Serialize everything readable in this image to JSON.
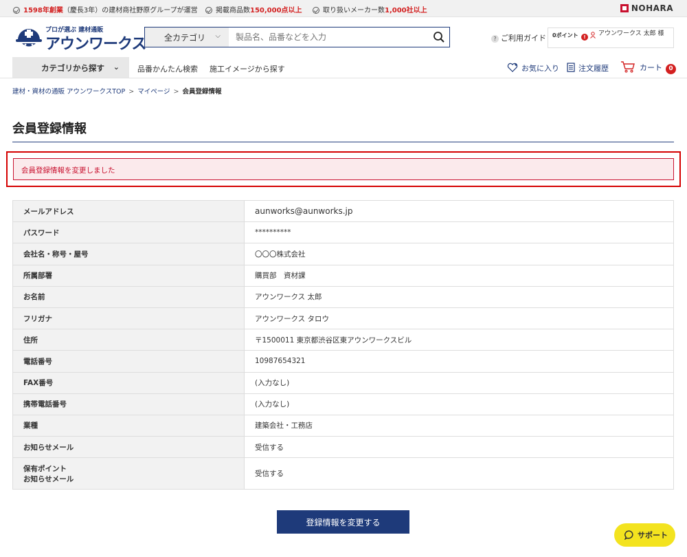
{
  "topbar": {
    "item1_red": "1598年創業",
    "item1_rest": "（慶長3年）の建材商社野原グループが運営",
    "item2_text": "掲載商品数",
    "item2_red": "150,000点以上",
    "item3_text": "取り扱いメーカー数",
    "item3_red": "1,000社以上",
    "brand": "NOHARA"
  },
  "header": {
    "logo_tagline": "プロが選ぶ 建材通販",
    "logo_name": "アウンワークス",
    "search_category": "全カテゴリ",
    "search_placeholder": "製品名、品番などを入力",
    "guide_label": "ご利用ガイド",
    "points": "0ポイント",
    "alert": "!",
    "user_name": "アウンワークス 太郎 様"
  },
  "nav": {
    "category_button": "カテゴリから探す",
    "links": [
      "品番かんたん検索",
      "施工イメージから探す"
    ],
    "favorites": "お気に入り",
    "order_history": "注文履歴",
    "cart": "カート",
    "cart_count": "0"
  },
  "breadcrumb": {
    "items": [
      "建材・資材の通販 アウンワークスTOP",
      "マイページ"
    ],
    "separator": ">",
    "current": "会員登録情報"
  },
  "page_title": "会員登録情報",
  "notice": "会員登録情報を変更しました",
  "info_rows": [
    {
      "label": "メールアドレス",
      "value": "aunworks@aunworks.jp"
    },
    {
      "label": "パスワード",
      "value": "**********"
    },
    {
      "label": "会社名・称号・屋号",
      "value": "〇〇〇株式会社"
    },
    {
      "label": "所属部署",
      "value": "購買部　資材課"
    },
    {
      "label": "お名前",
      "value": "アウンワークス 太郎"
    },
    {
      "label": "フリガナ",
      "value": "アウンワークス タロウ"
    },
    {
      "label": "住所",
      "value": "〒1500011 東京都渋谷区東アウンワークスビル"
    },
    {
      "label": "電話番号",
      "value": "10987654321"
    },
    {
      "label": "FAX番号",
      "value": "(入力なし)"
    },
    {
      "label": "携帯電話番号",
      "value": "(入力なし)"
    },
    {
      "label": "業種",
      "value": "建築会社・工務店"
    },
    {
      "label": "お知らせメール",
      "value": "受信する"
    },
    {
      "label_line1": "保有ポイント",
      "label_line2": "お知らせメール",
      "value": "受信する"
    }
  ],
  "submit_button": "登録情報を変更する",
  "support_button": "サポート",
  "colors": {
    "brand_navy": "#1e3a7a",
    "accent_red": "#d32020",
    "notice_bg": "#fbeaec",
    "support_yellow": "#f3e31f"
  }
}
